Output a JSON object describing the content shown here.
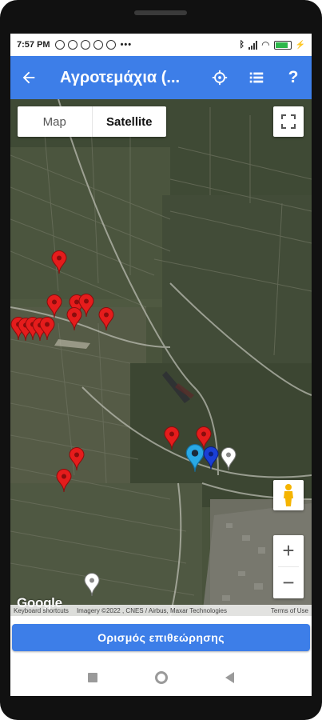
{
  "status_bar": {
    "time": "7:57 PM",
    "more": "•••",
    "battery_level": 0.85,
    "icons_left": [
      "sync-icon",
      "alarm-icon",
      "messenger-icon",
      "facebook-icon",
      "whatsapp-icon"
    ],
    "icons_right": [
      "bluetooth-icon",
      "signal-icon",
      "wifi-icon",
      "battery-icon",
      "charging-icon"
    ]
  },
  "app_bar": {
    "title": "Αγροτεμάχια (...",
    "back_icon": "arrow-back-icon",
    "actions": [
      "gps-icon",
      "list-icon",
      "help-icon"
    ],
    "background": "#3d7ee8"
  },
  "map": {
    "type_tabs": [
      "Map",
      "Satellite"
    ],
    "selected_tab": "Satellite",
    "google_label": "Google",
    "attribution": {
      "shortcuts": "Keyboard shortcuts",
      "imagery": "Imagery ©2022 , CNES / Airbus, Maxar Technologies",
      "terms": "Terms of Use"
    },
    "zoom_in": "+",
    "zoom_out": "−",
    "marker_colors": {
      "red": "#e51c1c",
      "white": "#ffffff",
      "blue": "#1a3fd6",
      "location": "#29a9e6"
    }
  },
  "primary_action": {
    "label": "Ορισμός επιθεώρησης",
    "color": "#3d7ee8"
  },
  "nav_bar": {
    "icons": [
      "recents-icon",
      "home-icon",
      "back-icon"
    ]
  }
}
